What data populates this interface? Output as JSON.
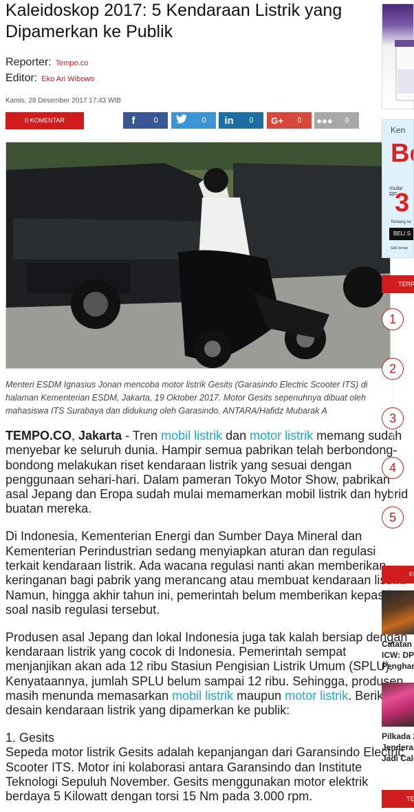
{
  "article": {
    "title": "Kaleidoskop 2017: 5 Kendaraan Listrik yang Dipamerkan ke Publik",
    "reporter_label": "Reporter:",
    "reporter_name": "Tempo.co",
    "editor_label": "Editor:",
    "editor_name": "Eko Ari Wibowo",
    "date": "Kamis, 28 Desember 2017 17:43 WIB",
    "comment_button": "0 KOMENTAR",
    "caption": "Menteri ESDM Ignasius Jonan mencoba motor listrik Gesits (Garasindo Electric Scooter ITS) di halaman Kementerian ESDM, Jakarta, 19 Oktober 2017. Motor Gesits sepenuhnya dibuat oleh mahasiswa ITS Surabaya dan didukung oleh Garasindo. ANTARA/Hafidz Mubarak A"
  },
  "share": {
    "facebook": {
      "icon": "facebook-icon",
      "count": "0"
    },
    "twitter": {
      "icon": "twitter-icon",
      "count": "0"
    },
    "linkedin": {
      "icon": "linkedin-icon",
      "count": "0"
    },
    "googleplus": {
      "icon": "googleplus-icon",
      "count": "0"
    },
    "more": {
      "icon": "more-icon",
      "count": "0"
    }
  },
  "body": {
    "p1": {
      "source": "TEMPO.CO",
      "sep": ", ",
      "city": "Jakarta",
      "lead": " - Tren ",
      "link1": "mobil listrik",
      "mid1": " dan ",
      "link2": "motor listrik",
      "rest": " memang sudah menyebar ke seluruh dunia. Hampir semua pabrikan telah berbondong-bondong melakukan riset kendaraan listrik yang sesuai dengan penggunaan sehari-hari. Dalam pameran Tokyo Motor Show, pabrikan asal Jepang dan Eropa sudah mulai memamerkan mobil listrik dan hybrid buatan mereka."
    },
    "p2": "Di Indonesia, Kementerian Energi dan Sumber Daya Mineral dan Kementerian Perindustrian sedang menyiapkan aturan dan regulasi terkait kendaraan listrik. Ada wacana regulasi nanti akan memberikan keringanan bagi pabrik yang merancang atau membuat kendaraan listrik. Namun, hingga akhir tahun ini, pemerintah belum memberikan kepastian soal nasib regulasi tersebut.",
    "p3": {
      "text": "Produsen asal Jepang dan lokal Indonesia juga tak kalah bersiap dengan kendaraan listrik yang cocok di Indonesia. Pemerintah sempat menjanjikan akan ada 12 ribu Stasiun Pengisian Listrik Umum (SPLU). Kenyataannya, jumlah SPLU belum sampai 12 ribu. Sehingga, produsen masih menunda memasarkan ",
      "link1": "mobil listrik",
      "mid": " maupun ",
      "link2": "motor listrik",
      "end": ". Berikut ini desain kendaraan listrik yang dipamerkan ke publik:"
    },
    "h1": "1. Gesits",
    "p4": "Sepeda motor listrik Gesits adalah kepanjangan dari Garansindo Electric Scooter ITS. Motor ini kolaborasi antara Garansindo dan Institute Teknologi Sepuluh November. Gesits menggunakan motor elektrik berdaya 5 Kilowatt dengan torsi 15 Nm pada 3.000 rpm."
  },
  "sidebar": {
    "ad2": {
      "t1": "Ken",
      "t2": "Bo",
      "t3": "mulai",
      "t3b": "RP",
      "t4": "3",
      "t5": "Terbang se",
      "btn": "BELI S",
      "t6": "S&K berlak"
    },
    "terpopuler_label": "TERPOPULER",
    "ranks": [
      "1",
      "2",
      "3",
      "4",
      "5"
    ],
    "foto_label": "FOTO",
    "items": [
      {
        "lines": [
          "Catatan",
          "ICW: DPR",
          "Penghar"
        ]
      },
      {
        "lines": [
          "Pilkada 2",
          "Jenderal",
          "Jadi Cale"
        ]
      }
    ],
    "bottom_label": "TERKINI"
  }
}
